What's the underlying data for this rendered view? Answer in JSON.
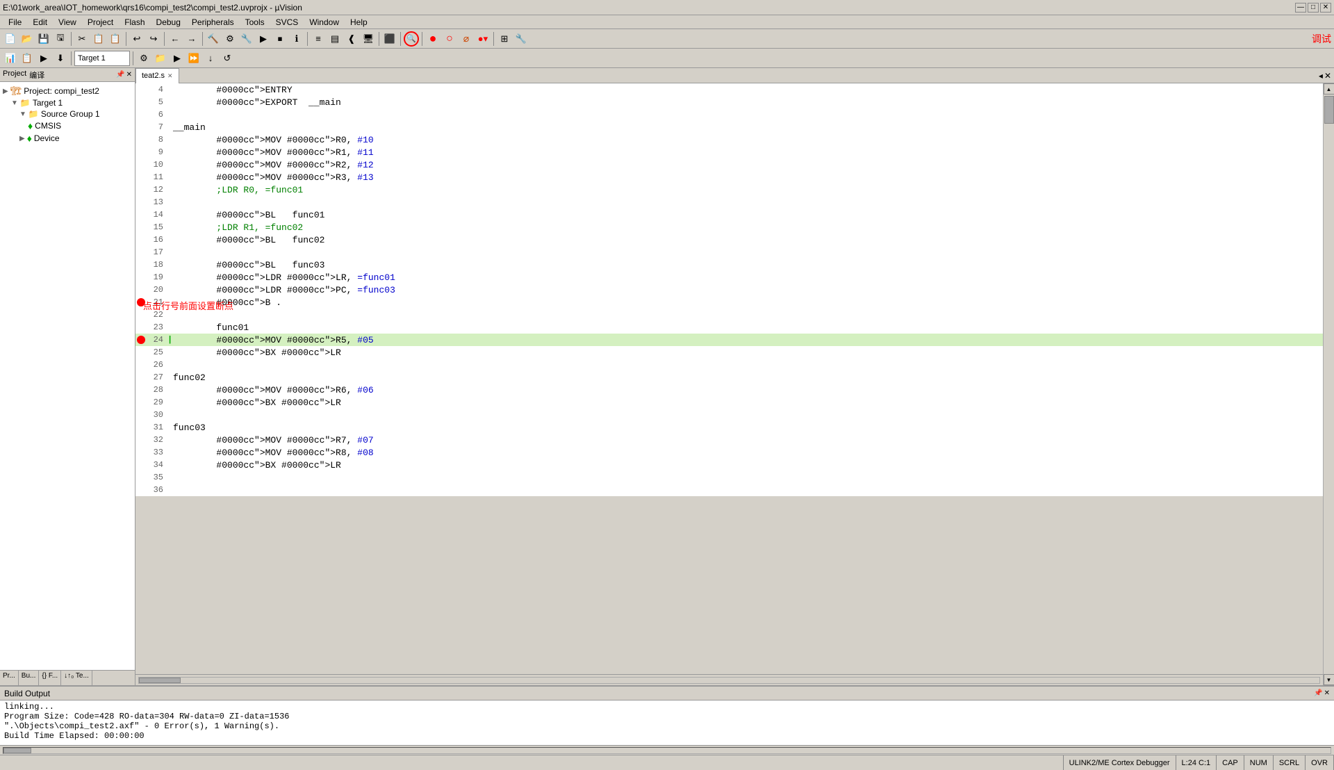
{
  "titleBar": {
    "text": "E:\\01work_area\\IOT_homework\\qrs16\\compi_test2\\compi_test2.uvprojx - µVision",
    "minimize": "—",
    "maximize": "□",
    "close": "✕"
  },
  "menuBar": {
    "items": [
      "File",
      "Edit",
      "View",
      "Project",
      "Flash",
      "Debug",
      "Peripherals",
      "Tools",
      "SVCS",
      "Window",
      "Help"
    ]
  },
  "toolbar": {
    "targetDropdown": "Target 1",
    "debugText": "调试"
  },
  "projectPanel": {
    "tabs": [
      "Project",
      "编译"
    ],
    "closeBtn": "✕",
    "pinBtn": "📌",
    "tree": {
      "projectLabel": "Project: compi_test2",
      "target": "Target 1",
      "sourceGroup": "Source Group 1",
      "cmsis": "CMSIS",
      "device": "Device"
    }
  },
  "panelBottomTabs": [
    "Pr...",
    "Bu...",
    "{} F...",
    "↓↑₀ Te..."
  ],
  "editorTab": {
    "filename": "teat2.s",
    "closeIcon": "✕"
  },
  "codeLines": [
    {
      "num": 4,
      "bp": false,
      "cursor": false,
      "highlight": false,
      "code": "        ENTRY"
    },
    {
      "num": 5,
      "bp": false,
      "cursor": false,
      "highlight": false,
      "code": "        EXPORT  __main"
    },
    {
      "num": 6,
      "bp": false,
      "cursor": false,
      "highlight": false,
      "code": ""
    },
    {
      "num": 7,
      "bp": false,
      "cursor": false,
      "highlight": false,
      "code": "__main"
    },
    {
      "num": 8,
      "bp": false,
      "cursor": false,
      "highlight": false,
      "code": "        MOV R0, #10"
    },
    {
      "num": 9,
      "bp": false,
      "cursor": false,
      "highlight": false,
      "code": "        MOV R1, #11"
    },
    {
      "num": 10,
      "bp": false,
      "cursor": false,
      "highlight": false,
      "code": "        MOV R2, #12"
    },
    {
      "num": 11,
      "bp": false,
      "cursor": false,
      "highlight": false,
      "code": "        MOV R3, #13"
    },
    {
      "num": 12,
      "bp": false,
      "cursor": false,
      "highlight": false,
      "code": "        ;LDR R0, =func01"
    },
    {
      "num": 13,
      "bp": false,
      "cursor": false,
      "highlight": false,
      "code": ""
    },
    {
      "num": 14,
      "bp": false,
      "cursor": false,
      "highlight": false,
      "code": "        BL   func01"
    },
    {
      "num": 15,
      "bp": false,
      "cursor": false,
      "highlight": false,
      "code": "        ;LDR R1, =func02"
    },
    {
      "num": 16,
      "bp": false,
      "cursor": false,
      "highlight": false,
      "code": "        BL   func02"
    },
    {
      "num": 17,
      "bp": false,
      "cursor": false,
      "highlight": false,
      "code": ""
    },
    {
      "num": 18,
      "bp": false,
      "cursor": false,
      "highlight": false,
      "code": "        BL   func03"
    },
    {
      "num": 19,
      "bp": false,
      "cursor": false,
      "highlight": false,
      "code": "        LDR LR, =func01"
    },
    {
      "num": 20,
      "bp": false,
      "cursor": false,
      "highlight": false,
      "code": "        LDR PC, =func03"
    },
    {
      "num": 21,
      "bp": true,
      "cursor": false,
      "highlight": false,
      "code": "        B ."
    },
    {
      "num": 22,
      "bp": false,
      "cursor": false,
      "highlight": false,
      "code": ""
    },
    {
      "num": 23,
      "bp": false,
      "cursor": false,
      "highlight": false,
      "code": "        func01"
    },
    {
      "num": 24,
      "bp": true,
      "cursor": true,
      "highlight": true,
      "code": "        MOV R5, #05"
    },
    {
      "num": 25,
      "bp": false,
      "cursor": false,
      "highlight": false,
      "code": "        BX LR"
    },
    {
      "num": 26,
      "bp": false,
      "cursor": false,
      "highlight": false,
      "code": ""
    },
    {
      "num": 27,
      "bp": false,
      "cursor": false,
      "highlight": false,
      "code": "func02"
    },
    {
      "num": 28,
      "bp": false,
      "cursor": false,
      "highlight": false,
      "code": "        MOV R6, #06"
    },
    {
      "num": 29,
      "bp": false,
      "cursor": false,
      "highlight": false,
      "code": "        BX LR"
    },
    {
      "num": 30,
      "bp": false,
      "cursor": false,
      "highlight": false,
      "code": ""
    },
    {
      "num": 31,
      "bp": false,
      "cursor": false,
      "highlight": false,
      "code": "func03"
    },
    {
      "num": 32,
      "bp": false,
      "cursor": false,
      "highlight": false,
      "code": "        MOV R7, #07"
    },
    {
      "num": 33,
      "bp": false,
      "cursor": false,
      "highlight": false,
      "code": "        MOV R8, #08"
    },
    {
      "num": 34,
      "bp": false,
      "cursor": false,
      "highlight": false,
      "code": "        BX LR"
    },
    {
      "num": 35,
      "bp": false,
      "cursor": false,
      "highlight": false,
      "code": ""
    },
    {
      "num": 36,
      "bp": false,
      "cursor": false,
      "highlight": false,
      "code": ""
    }
  ],
  "tooltip": {
    "text": "点击行号前面设置断点"
  },
  "buildOutput": {
    "title": "Build Output",
    "lines": [
      "linking...",
      "Program Size: Code=428  RO-data=304  RW-data=0  ZI-data=1536",
      "\".\\Objects\\compi_test2.axf\" - 0 Error(s), 1 Warning(s).",
      "Build Time Elapsed:  00:00:00"
    ]
  },
  "statusBar": {
    "debugger": "ULINK2/ME Cortex Debugger",
    "cursor": "L:24 C:1",
    "cap": "CAP",
    "num": "NUM",
    "scrl": "SCRL",
    "ovr": "OVR"
  }
}
